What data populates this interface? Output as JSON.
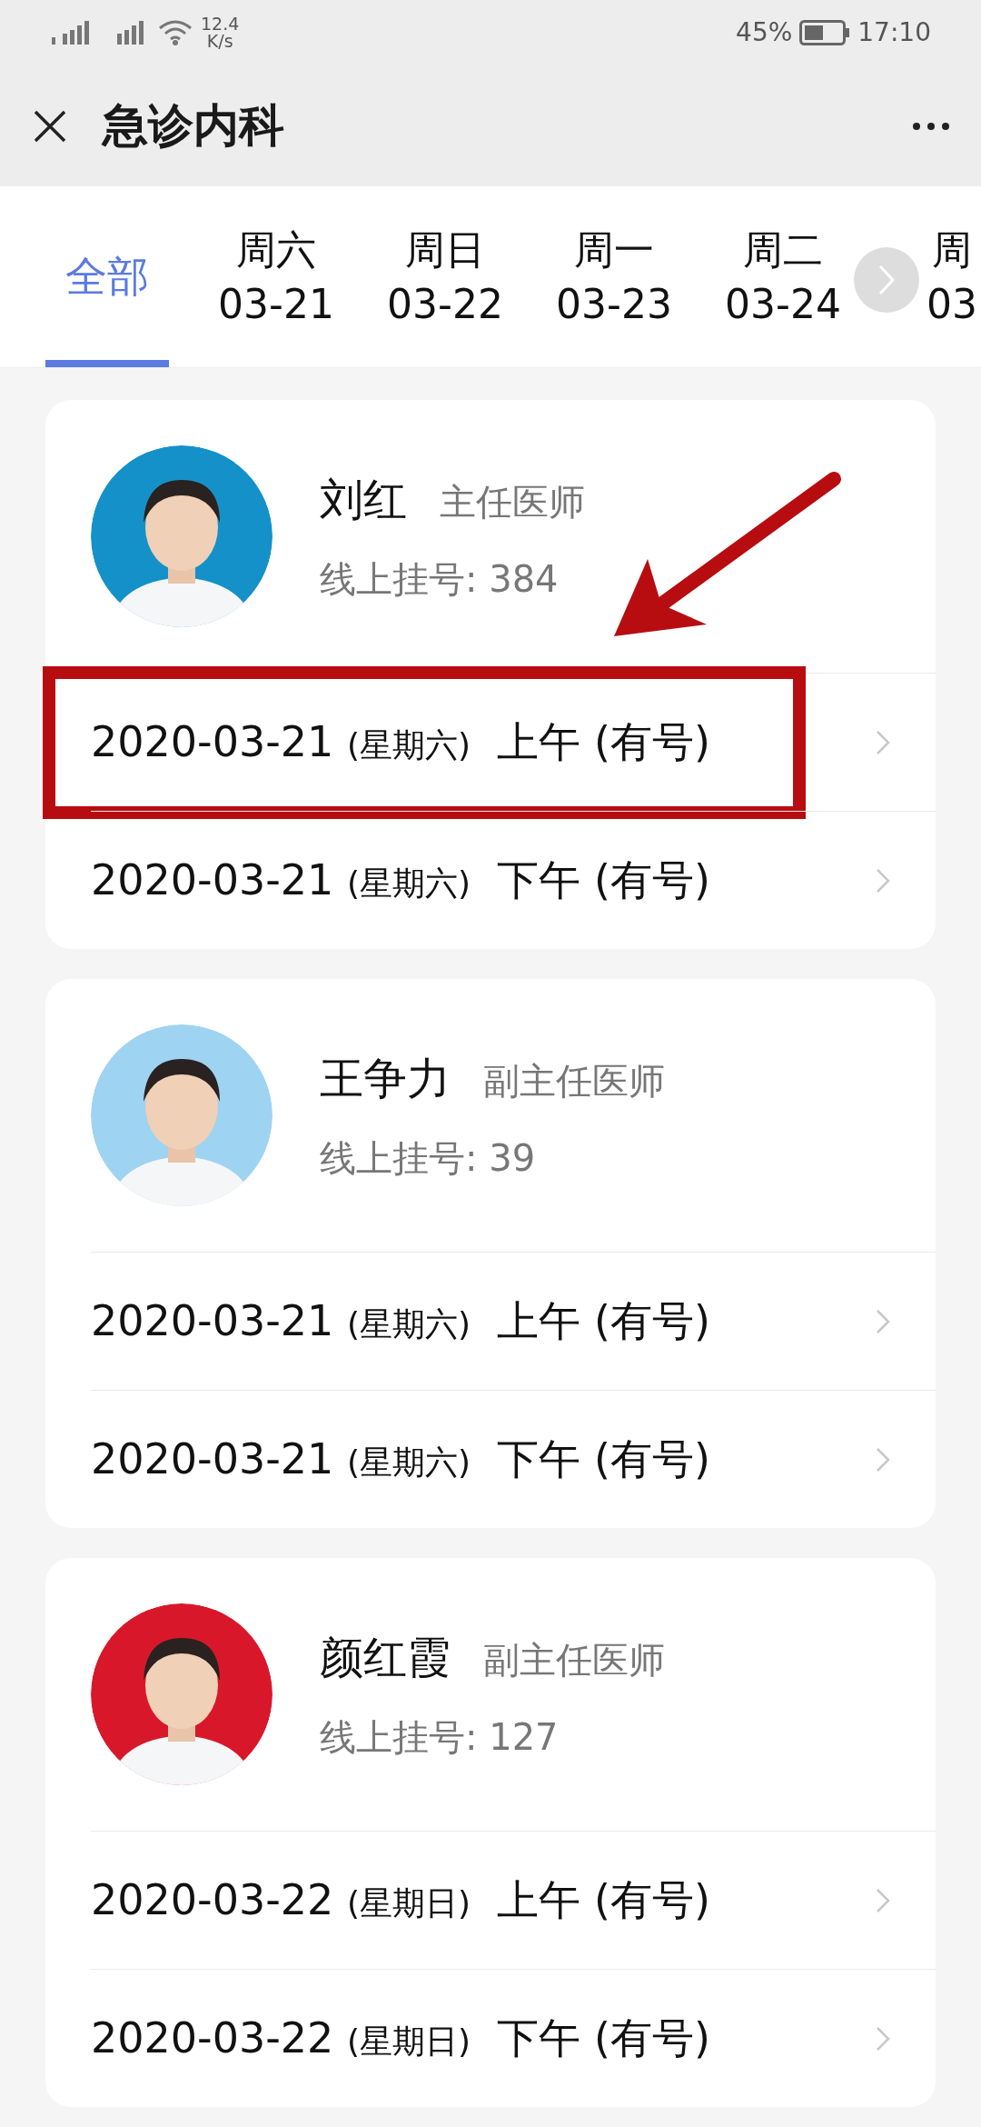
{
  "status_bar": {
    "speed": "12.4",
    "speed_unit": "K/s",
    "battery": "45%",
    "time": "17:10"
  },
  "title_bar": {
    "title": "急诊内科"
  },
  "tabs": [
    {
      "kind": "all",
      "label": "全部",
      "selected": true
    },
    {
      "kind": "day",
      "weekday": "周六",
      "date": "03-21",
      "selected": false
    },
    {
      "kind": "day",
      "weekday": "周日",
      "date": "03-22",
      "selected": false
    },
    {
      "kind": "day",
      "weekday": "周一",
      "date": "03-23",
      "selected": false
    },
    {
      "kind": "day",
      "weekday": "周二",
      "date": "03-24",
      "selected": false
    },
    {
      "kind": "day",
      "weekday": "周",
      "date": "03",
      "selected": false
    }
  ],
  "doctors": [
    {
      "name": "刘红",
      "title": "主任医师",
      "bookings": "线上挂号: 384",
      "avatar": {
        "kind": "picture",
        "color": "#1591c9"
      },
      "slots": [
        {
          "date": "2020-03-21",
          "weekday": "(星期六)",
          "period": "上午 (有号)",
          "highlighted": true
        },
        {
          "date": "2020-03-21",
          "weekday": "(星期六)",
          "period": "下午 (有号)",
          "highlighted": false
        }
      ]
    },
    {
      "name": "王争力",
      "title": "副主任医师",
      "bookings": "线上挂号: 39",
      "avatar": {
        "kind": "picture",
        "color": "#9fd3f2"
      },
      "slots": [
        {
          "date": "2020-03-21",
          "weekday": "(星期六)",
          "period": "上午 (有号)",
          "highlighted": false
        },
        {
          "date": "2020-03-21",
          "weekday": "(星期六)",
          "period": "下午 (有号)",
          "highlighted": false
        }
      ]
    },
    {
      "name": "颜红霞",
      "title": "副主任医师",
      "bookings": "线上挂号: 127",
      "avatar": {
        "kind": "picture",
        "color": "#d8182a"
      },
      "slots": [
        {
          "date": "2020-03-22",
          "weekday": "(星期日)",
          "period": "上午 (有号)",
          "highlighted": false
        },
        {
          "date": "2020-03-22",
          "weekday": "(星期日)",
          "period": "下午 (有号)",
          "highlighted": false
        }
      ]
    }
  ]
}
